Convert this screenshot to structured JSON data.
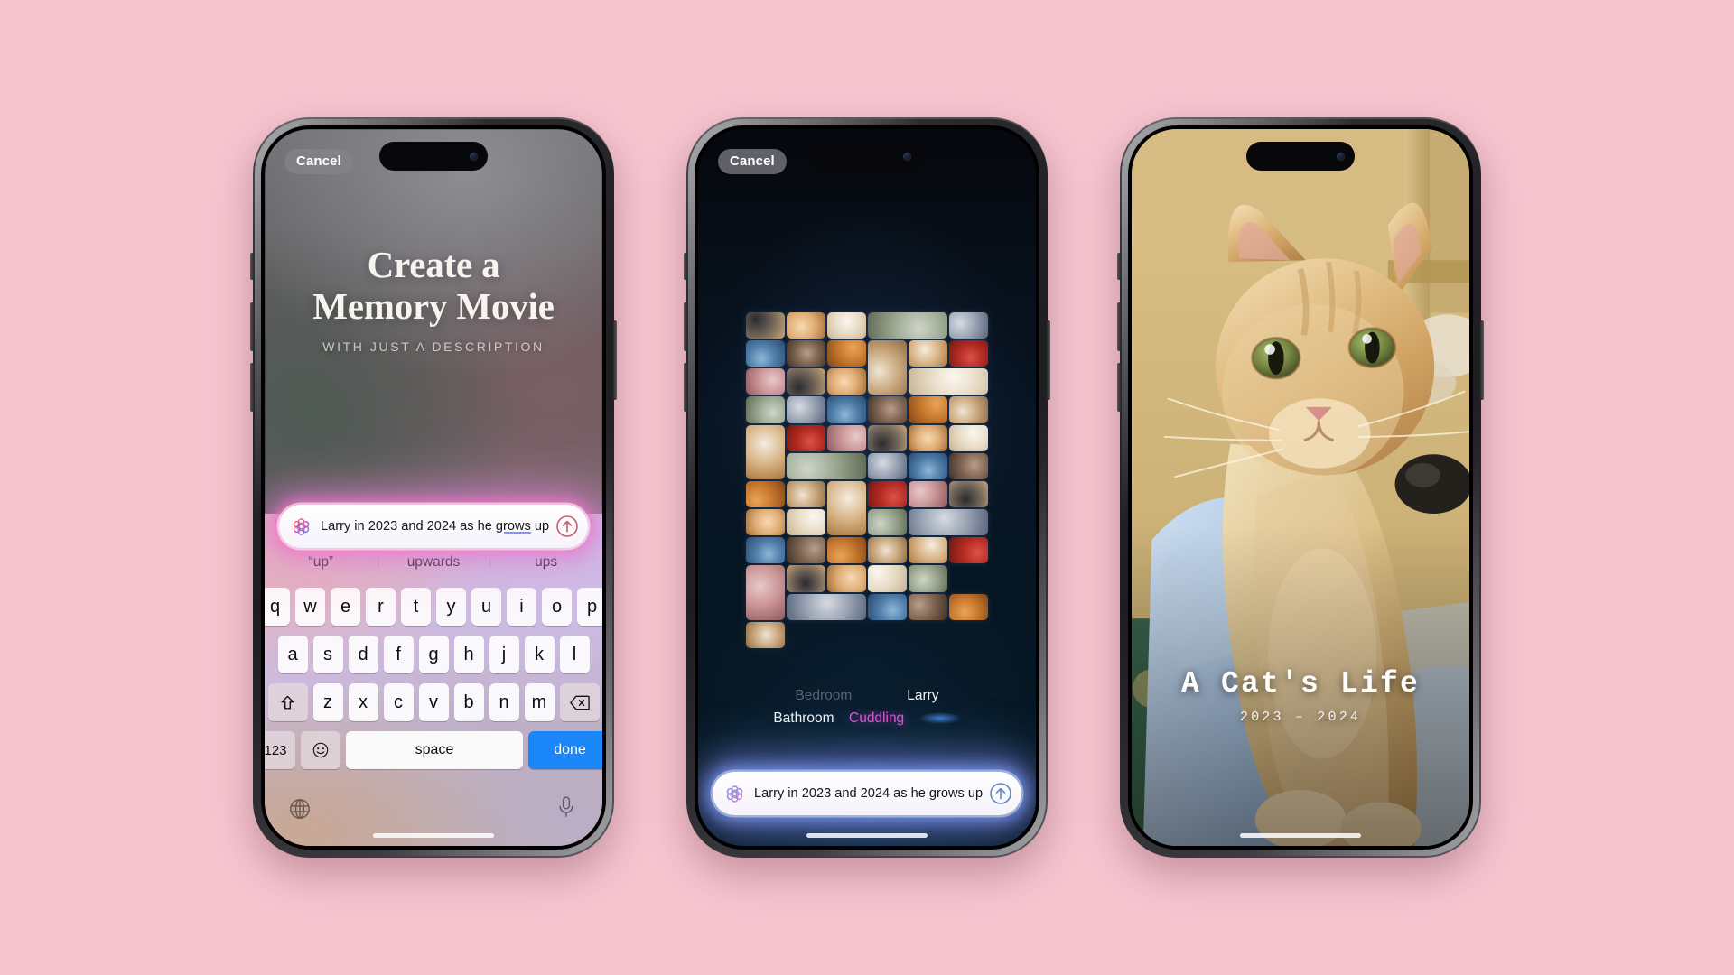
{
  "background_color": "#f6c4cf",
  "phone1": {
    "name": "prompt-entry-screen",
    "cancel_label": "Cancel",
    "headline_line1": "Create a",
    "headline_line2": "Memory Movie",
    "subhead": "WITH JUST A DESCRIPTION",
    "prompt": {
      "icon": "ai-sparkle-orb-icon",
      "text_before": "Larry in 2023 and 2024 as he ",
      "text_misspelled": "grows",
      "text_after": " up",
      "full_text": "Larry in 2023 and 2024 as he grows up",
      "send_icon": "arrow-up-circle-icon"
    },
    "keyboard": {
      "suggestions": [
        "“up”",
        "upwards",
        "ups"
      ],
      "row1": [
        "q",
        "w",
        "e",
        "r",
        "t",
        "y",
        "u",
        "i",
        "o",
        "p"
      ],
      "row2": [
        "a",
        "s",
        "d",
        "f",
        "g",
        "h",
        "j",
        "k",
        "l"
      ],
      "row3": [
        "z",
        "x",
        "c",
        "v",
        "b",
        "n",
        "m"
      ],
      "shift_icon": "shift-arrow-icon",
      "backspace_icon": "backspace-icon",
      "numeric_label": "123",
      "emoji_icon": "emoji-smiley-icon",
      "space_label": "space",
      "done_label": "done",
      "globe_icon": "globe-language-icon",
      "mic_icon": "microphone-icon",
      "done_color": "#1b86f7"
    }
  },
  "phone2": {
    "name": "memory-building-screen",
    "cancel_label": "Cancel",
    "labels": {
      "row1": [
        {
          "text": "Bedroom",
          "style": "dim"
        },
        {
          "text": "Larry",
          "style": "white"
        }
      ],
      "row2": [
        {
          "text": "Bathroom",
          "style": "white"
        },
        {
          "text": "Cuddling",
          "style": "pink"
        },
        {
          "text": "",
          "style": "blob"
        }
      ]
    },
    "accent_pink": "#e152d8",
    "prompt": {
      "icon": "ai-sparkle-orb-icon",
      "full_text": "Larry in 2023 and 2024 as he grows up",
      "send_icon": "arrow-up-circle-icon"
    }
  },
  "phone3": {
    "name": "memory-movie-result-screen",
    "movie_title": "A Cat's Life",
    "movie_years": "2023 – 2024",
    "photo_subject": "orange-tabby-kitten-held-in-arms"
  }
}
